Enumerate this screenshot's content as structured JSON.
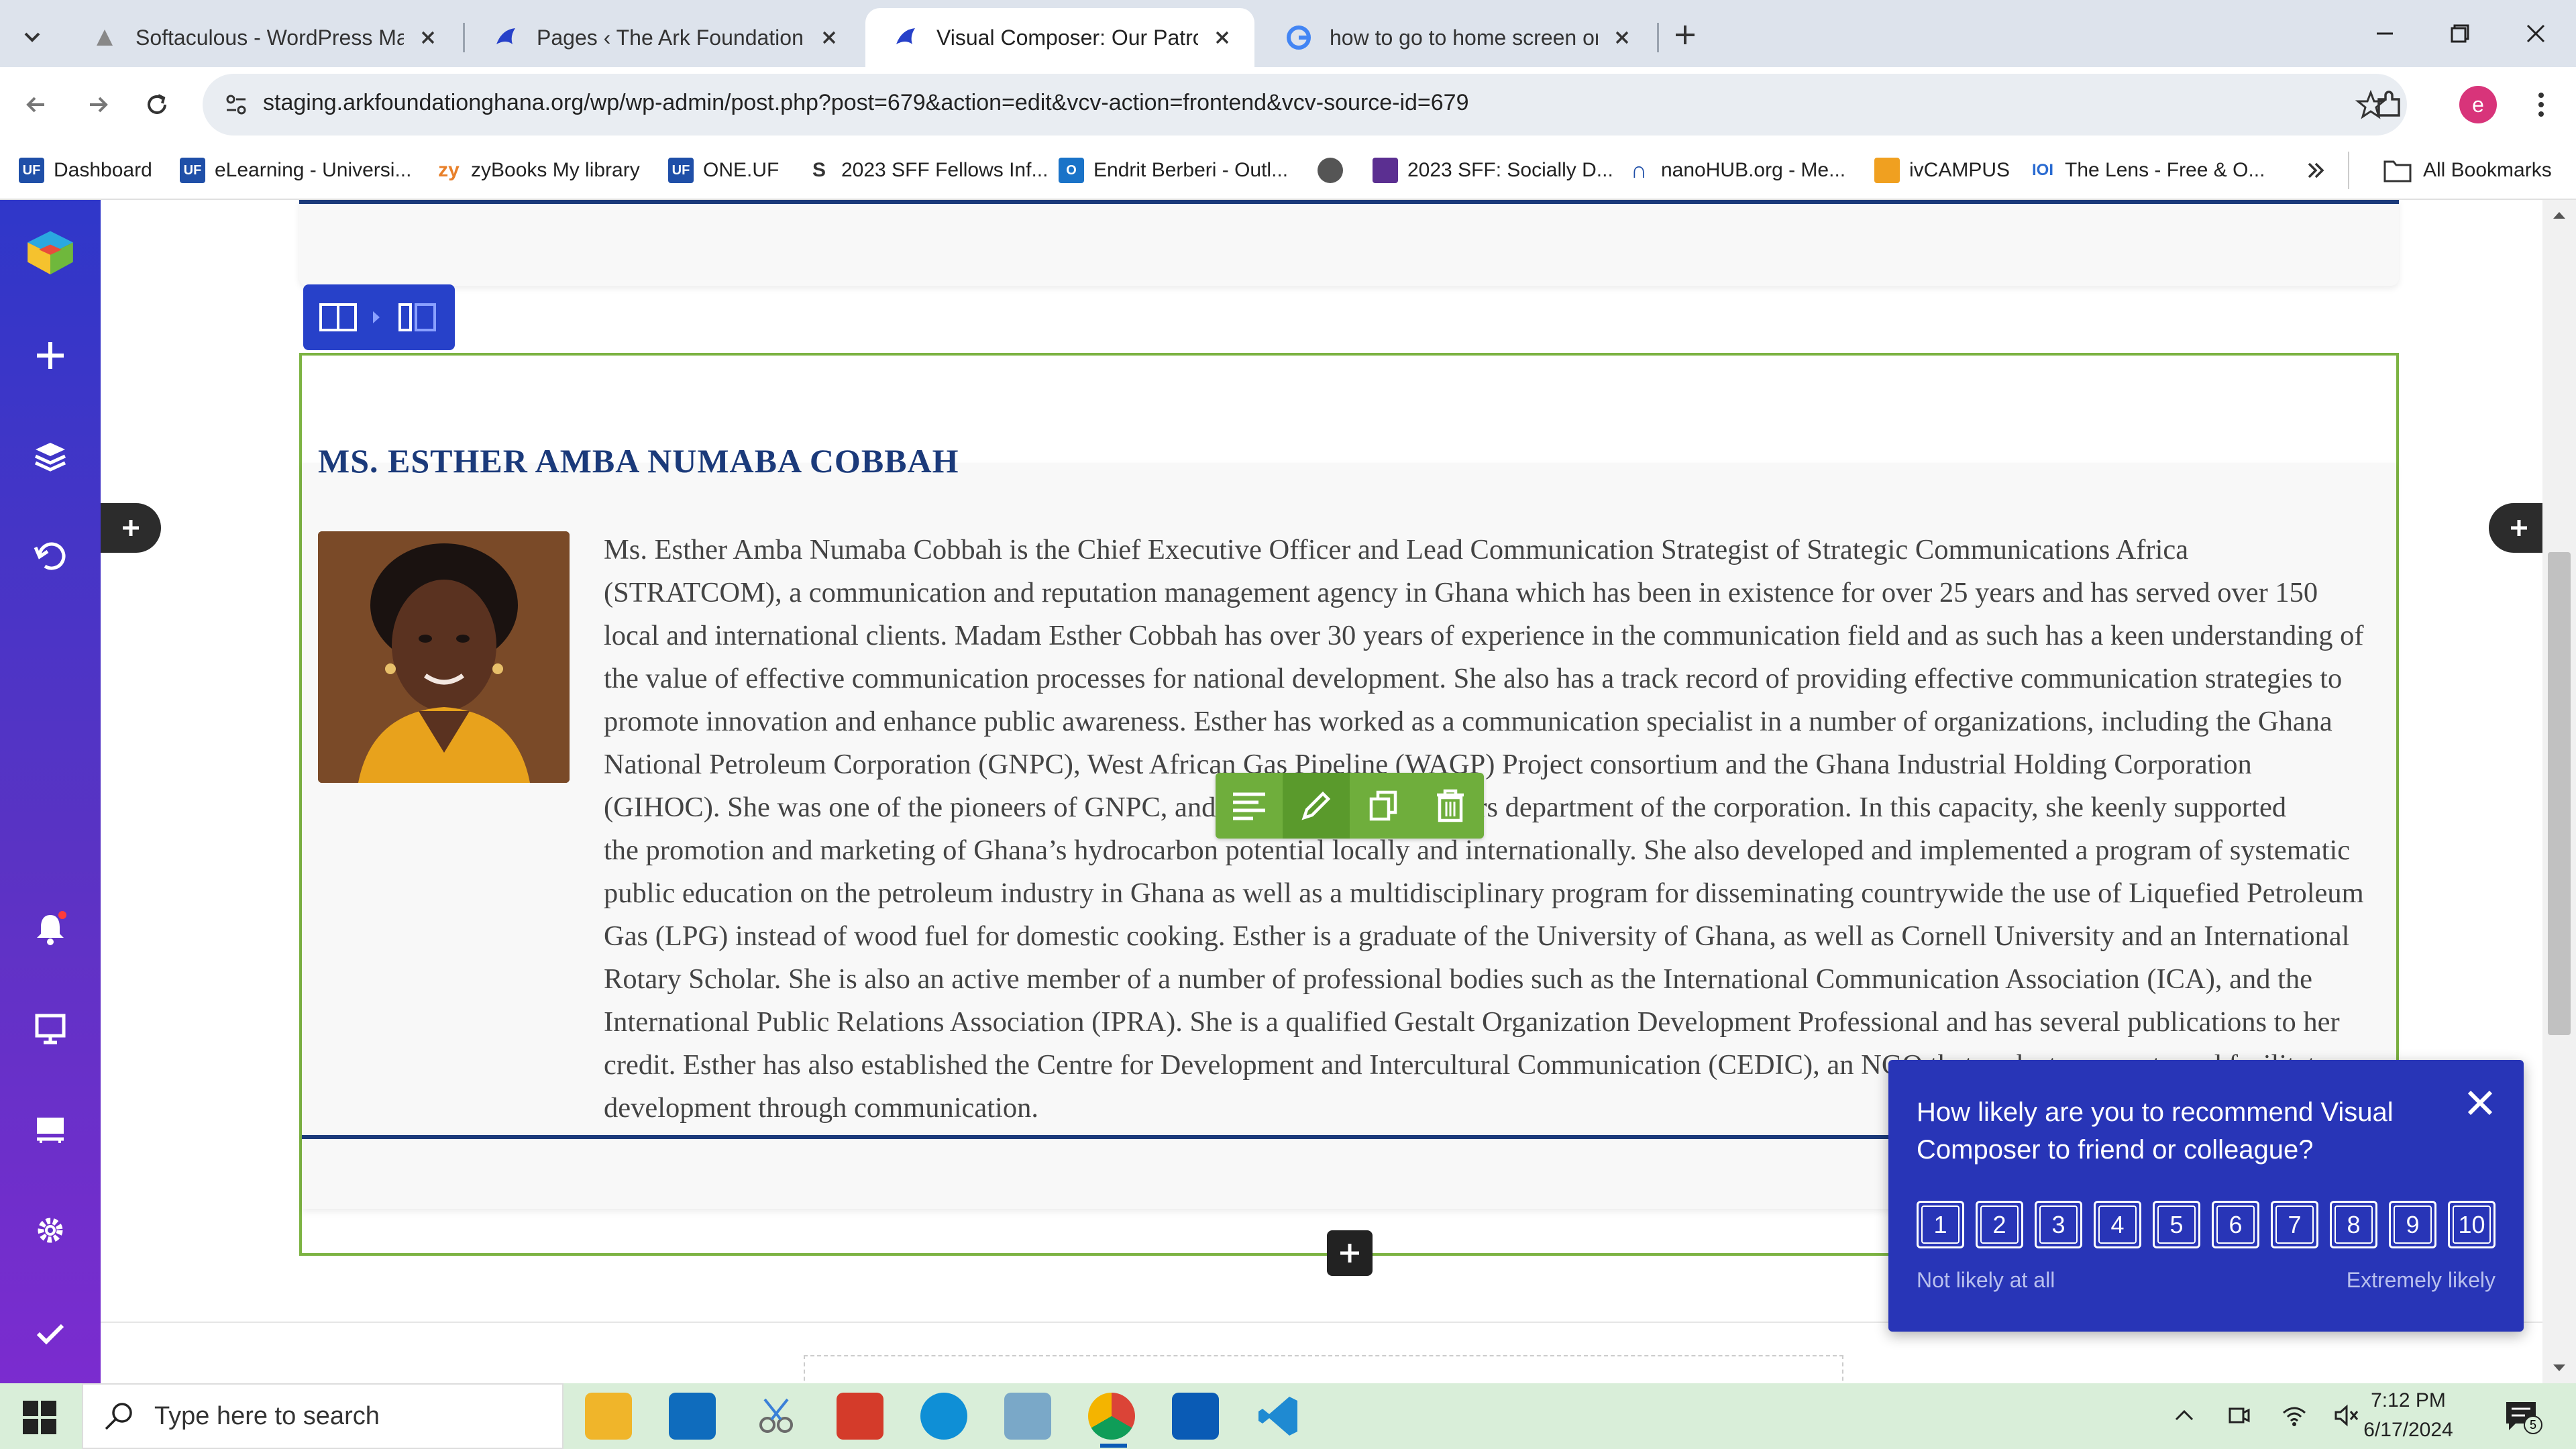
{
  "browser": {
    "tabs": [
      {
        "title": "Softaculous - WordPress Manag",
        "favicon": "softaculous-icon",
        "active": false
      },
      {
        "title": "Pages ‹ The Ark Foundation, Gh",
        "favicon": "bird-icon",
        "active": false
      },
      {
        "title": "Visual Composer: Our Patrons",
        "favicon": "bird-icon",
        "active": true
      },
      {
        "title": "how to go to home screen on v",
        "favicon": "google-icon",
        "active": false
      }
    ],
    "url": "staging.arkfoundationghana.org/wp/wp-admin/post.php?post=679&action=edit&vcv-action=frontend&vcv-source-id=679",
    "profile_initial": "e",
    "bookmarks": [
      {
        "label": "Dashboard",
        "icon": "uf-icon"
      },
      {
        "label": "eLearning - Universi...",
        "icon": "uf-icon"
      },
      {
        "label": "zyBooks My library",
        "icon": "zy-icon"
      },
      {
        "label": "ONE.UF",
        "icon": "uf-icon"
      },
      {
        "label": "2023 SFF Fellows Inf...",
        "icon": "s-icon"
      },
      {
        "label": "Endrit Berberi - Outl...",
        "icon": "outlook-icon"
      },
      {
        "label": "",
        "icon": "globe-icon"
      },
      {
        "label": "2023 SFF: Socially D...",
        "icon": "cube-icon"
      },
      {
        "label": "nanoHUB.org - Me...",
        "icon": "nanohub-icon"
      },
      {
        "label": "ivCAMPUS",
        "icon": "ivcampus-icon"
      },
      {
        "label": "The Lens - Free & O...",
        "icon": "lens-icon"
      }
    ],
    "all_bookmarks": "All Bookmarks"
  },
  "editor": {
    "patron_name": "MS. ESTHER AMBA NUMABA COBBAH",
    "bio_lines": [
      "Ms. Esther Amba Numaba Cobbah is the Chief Executive Officer and Lead Communication Strategist of Strategic Communications Africa",
      "(STRATCOM), a communication and reputation management agency in Ghana which has been in existence for over 25 years and has served over 150",
      "local and international clients. Madam Esther Cobbah has over 30 years of experience in the communication field and as such has a keen understanding of",
      "the value of effective communication processes for national development. She also has a track record of providing effective communication strategies to",
      "promote innovation and enhance public awareness. Esther has worked as a communication specialist in a number of organizations, including the Ghana",
      "National Petroleum Corporation (GNPC), West African Gas Pipeline (WAGP) Project consortium and the Ghana Industrial Holding Corporation",
      "(GIHOC). She was one of the pioneers of GNPC, and set up the Public Affairs department of the corporation. In this capacity, she keenly supported",
      "the promotion and marketing of Ghana’s hydrocarbon potential locally and internationally. She also developed and implemented a program of systematic",
      "public education on the petroleum industry in Ghana as well as a multidisciplinary program for disseminating countrywide the use of Liquefied Petroleum",
      "Gas (LPG) instead of wood fuel for domestic cooking. Esther is a graduate of the University of Ghana, as well as Cornell University and an International",
      "Rotary Scholar. She is also an active member of a number of professional bodies such as the International Communication Association (ICA), and the",
      "International Public Relations Association (IPRA). She is a qualified Gestalt Organization Development Professional and has several publications to her",
      "credit. Esther has also established the Centre for Development and Intercultural Communication (CEDIC), an NGO that seeks to promote and facilitate",
      "development through communication."
    ]
  },
  "survey": {
    "question": "How likely are you to recommend Visual Composer to friend or colleague?",
    "scale": [
      "1",
      "2",
      "3",
      "4",
      "5",
      "6",
      "7",
      "8",
      "9",
      "10"
    ],
    "low_label": "Not likely at all",
    "high_label": "Extremely likely"
  },
  "taskbar": {
    "search_placeholder": "Type here to search",
    "time": "7:12 PM",
    "date": "6/17/2024",
    "notification_count": "5"
  },
  "colors": {
    "vc_accent": "#2741c9",
    "row_outline": "#7cb342",
    "element_toolbar": "#6fae3c",
    "heading": "#1b3a7a",
    "survey_bg": "#2835b7"
  }
}
